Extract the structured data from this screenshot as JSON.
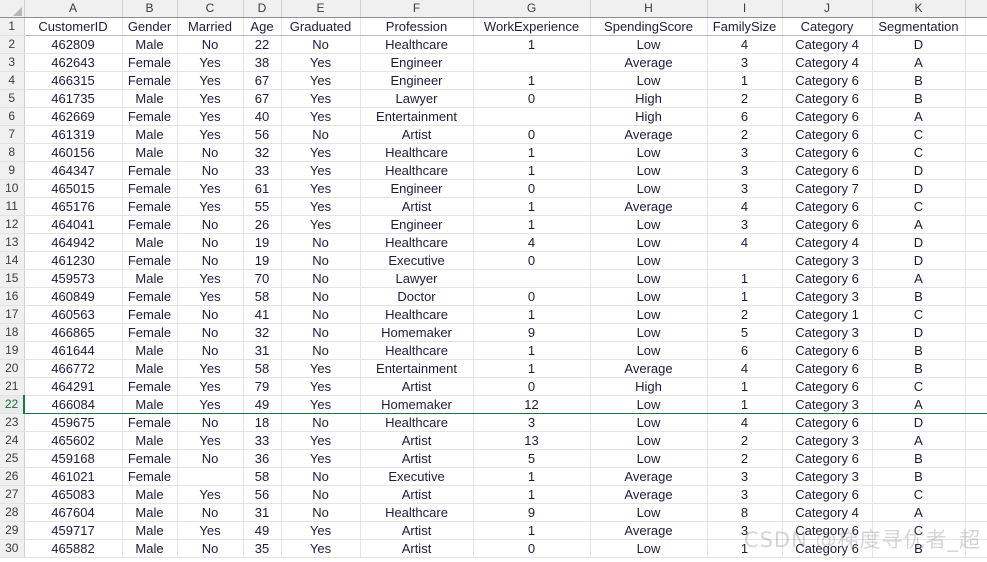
{
  "spreadsheet": {
    "select_all_icon": "select-all-triangle",
    "column_letters": [
      "A",
      "B",
      "C",
      "D",
      "E",
      "F",
      "G",
      "H",
      "I",
      "J",
      "K",
      ""
    ],
    "selected_row_number": "22",
    "header_row_number": "1",
    "headers": [
      "CustomerID",
      "Gender",
      "Married",
      "Age",
      "Graduated",
      "Profession",
      "WorkExperience",
      "SpendingScore",
      "FamilySize",
      "Category",
      "Segmentation",
      ""
    ],
    "row_numbers": [
      "2",
      "3",
      "4",
      "5",
      "6",
      "7",
      "8",
      "9",
      "10",
      "11",
      "12",
      "13",
      "14",
      "15",
      "16",
      "17",
      "18",
      "19",
      "20",
      "21",
      "22",
      "23",
      "24",
      "25",
      "26",
      "27",
      "28",
      "29",
      "30"
    ],
    "rows": [
      [
        "462809",
        "Male",
        "No",
        "22",
        "No",
        "Healthcare",
        "1",
        "Low",
        "4",
        "Category 4",
        "D",
        ""
      ],
      [
        "462643",
        "Female",
        "Yes",
        "38",
        "Yes",
        "Engineer",
        "",
        "Average",
        "3",
        "Category 4",
        "A",
        ""
      ],
      [
        "466315",
        "Female",
        "Yes",
        "67",
        "Yes",
        "Engineer",
        "1",
        "Low",
        "1",
        "Category 6",
        "B",
        ""
      ],
      [
        "461735",
        "Male",
        "Yes",
        "67",
        "Yes",
        "Lawyer",
        "0",
        "High",
        "2",
        "Category 6",
        "B",
        ""
      ],
      [
        "462669",
        "Female",
        "Yes",
        "40",
        "Yes",
        "Entertainment",
        "",
        "High",
        "6",
        "Category 6",
        "A",
        ""
      ],
      [
        "461319",
        "Male",
        "Yes",
        "56",
        "No",
        "Artist",
        "0",
        "Average",
        "2",
        "Category 6",
        "C",
        ""
      ],
      [
        "460156",
        "Male",
        "No",
        "32",
        "Yes",
        "Healthcare",
        "1",
        "Low",
        "3",
        "Category 6",
        "C",
        ""
      ],
      [
        "464347",
        "Female",
        "No",
        "33",
        "Yes",
        "Healthcare",
        "1",
        "Low",
        "3",
        "Category 6",
        "D",
        ""
      ],
      [
        "465015",
        "Female",
        "Yes",
        "61",
        "Yes",
        "Engineer",
        "0",
        "Low",
        "3",
        "Category 7",
        "D",
        ""
      ],
      [
        "465176",
        "Female",
        "Yes",
        "55",
        "Yes",
        "Artist",
        "1",
        "Average",
        "4",
        "Category 6",
        "C",
        ""
      ],
      [
        "464041",
        "Female",
        "No",
        "26",
        "Yes",
        "Engineer",
        "1",
        "Low",
        "3",
        "Category 6",
        "A",
        ""
      ],
      [
        "464942",
        "Male",
        "No",
        "19",
        "No",
        "Healthcare",
        "4",
        "Low",
        "4",
        "Category 4",
        "D",
        ""
      ],
      [
        "461230",
        "Female",
        "No",
        "19",
        "No",
        "Executive",
        "0",
        "Low",
        "",
        "Category 3",
        "D",
        ""
      ],
      [
        "459573",
        "Male",
        "Yes",
        "70",
        "No",
        "Lawyer",
        "",
        "Low",
        "1",
        "Category 6",
        "A",
        ""
      ],
      [
        "460849",
        "Female",
        "Yes",
        "58",
        "No",
        "Doctor",
        "0",
        "Low",
        "1",
        "Category 3",
        "B",
        ""
      ],
      [
        "460563",
        "Female",
        "No",
        "41",
        "No",
        "Healthcare",
        "1",
        "Low",
        "2",
        "Category 1",
        "C",
        ""
      ],
      [
        "466865",
        "Female",
        "No",
        "32",
        "No",
        "Homemaker",
        "9",
        "Low",
        "5",
        "Category 3",
        "D",
        ""
      ],
      [
        "461644",
        "Male",
        "No",
        "31",
        "No",
        "Healthcare",
        "1",
        "Low",
        "6",
        "Category 6",
        "B",
        ""
      ],
      [
        "466772",
        "Male",
        "Yes",
        "58",
        "Yes",
        "Entertainment",
        "1",
        "Average",
        "4",
        "Category 6",
        "B",
        ""
      ],
      [
        "464291",
        "Female",
        "Yes",
        "79",
        "Yes",
        "Artist",
        "0",
        "High",
        "1",
        "Category 6",
        "C",
        ""
      ],
      [
        "466084",
        "Male",
        "Yes",
        "49",
        "Yes",
        "Homemaker",
        "12",
        "Low",
        "1",
        "Category 3",
        "A",
        ""
      ],
      [
        "459675",
        "Female",
        "No",
        "18",
        "No",
        "Healthcare",
        "3",
        "Low",
        "4",
        "Category 6",
        "D",
        ""
      ],
      [
        "465602",
        "Male",
        "Yes",
        "33",
        "Yes",
        "Artist",
        "13",
        "Low",
        "2",
        "Category 3",
        "A",
        ""
      ],
      [
        "459168",
        "Female",
        "No",
        "36",
        "Yes",
        "Artist",
        "5",
        "Low",
        "2",
        "Category 6",
        "B",
        ""
      ],
      [
        "461021",
        "Female",
        "",
        "58",
        "No",
        "Executive",
        "1",
        "Average",
        "3",
        "Category 3",
        "B",
        ""
      ],
      [
        "465083",
        "Male",
        "Yes",
        "56",
        "No",
        "Artist",
        "1",
        "Average",
        "3",
        "Category 6",
        "C",
        ""
      ],
      [
        "467604",
        "Male",
        "No",
        "31",
        "No",
        "Healthcare",
        "9",
        "Low",
        "8",
        "Category 4",
        "A",
        ""
      ],
      [
        "459717",
        "Male",
        "Yes",
        "49",
        "Yes",
        "Artist",
        "1",
        "Average",
        "3",
        "Category 6",
        "C",
        ""
      ],
      [
        "465882",
        "Male",
        "No",
        "35",
        "Yes",
        "Artist",
        "0",
        "Low",
        "1",
        "Category 6",
        "B",
        ""
      ]
    ]
  },
  "watermark": {
    "text": "CSDN @梯度寻优者_超"
  },
  "colors": {
    "header_background": "#f0f0f0",
    "gridline": "#e4e4e4",
    "text": "#1c1c3c",
    "selection_accent": "#127b45"
  }
}
